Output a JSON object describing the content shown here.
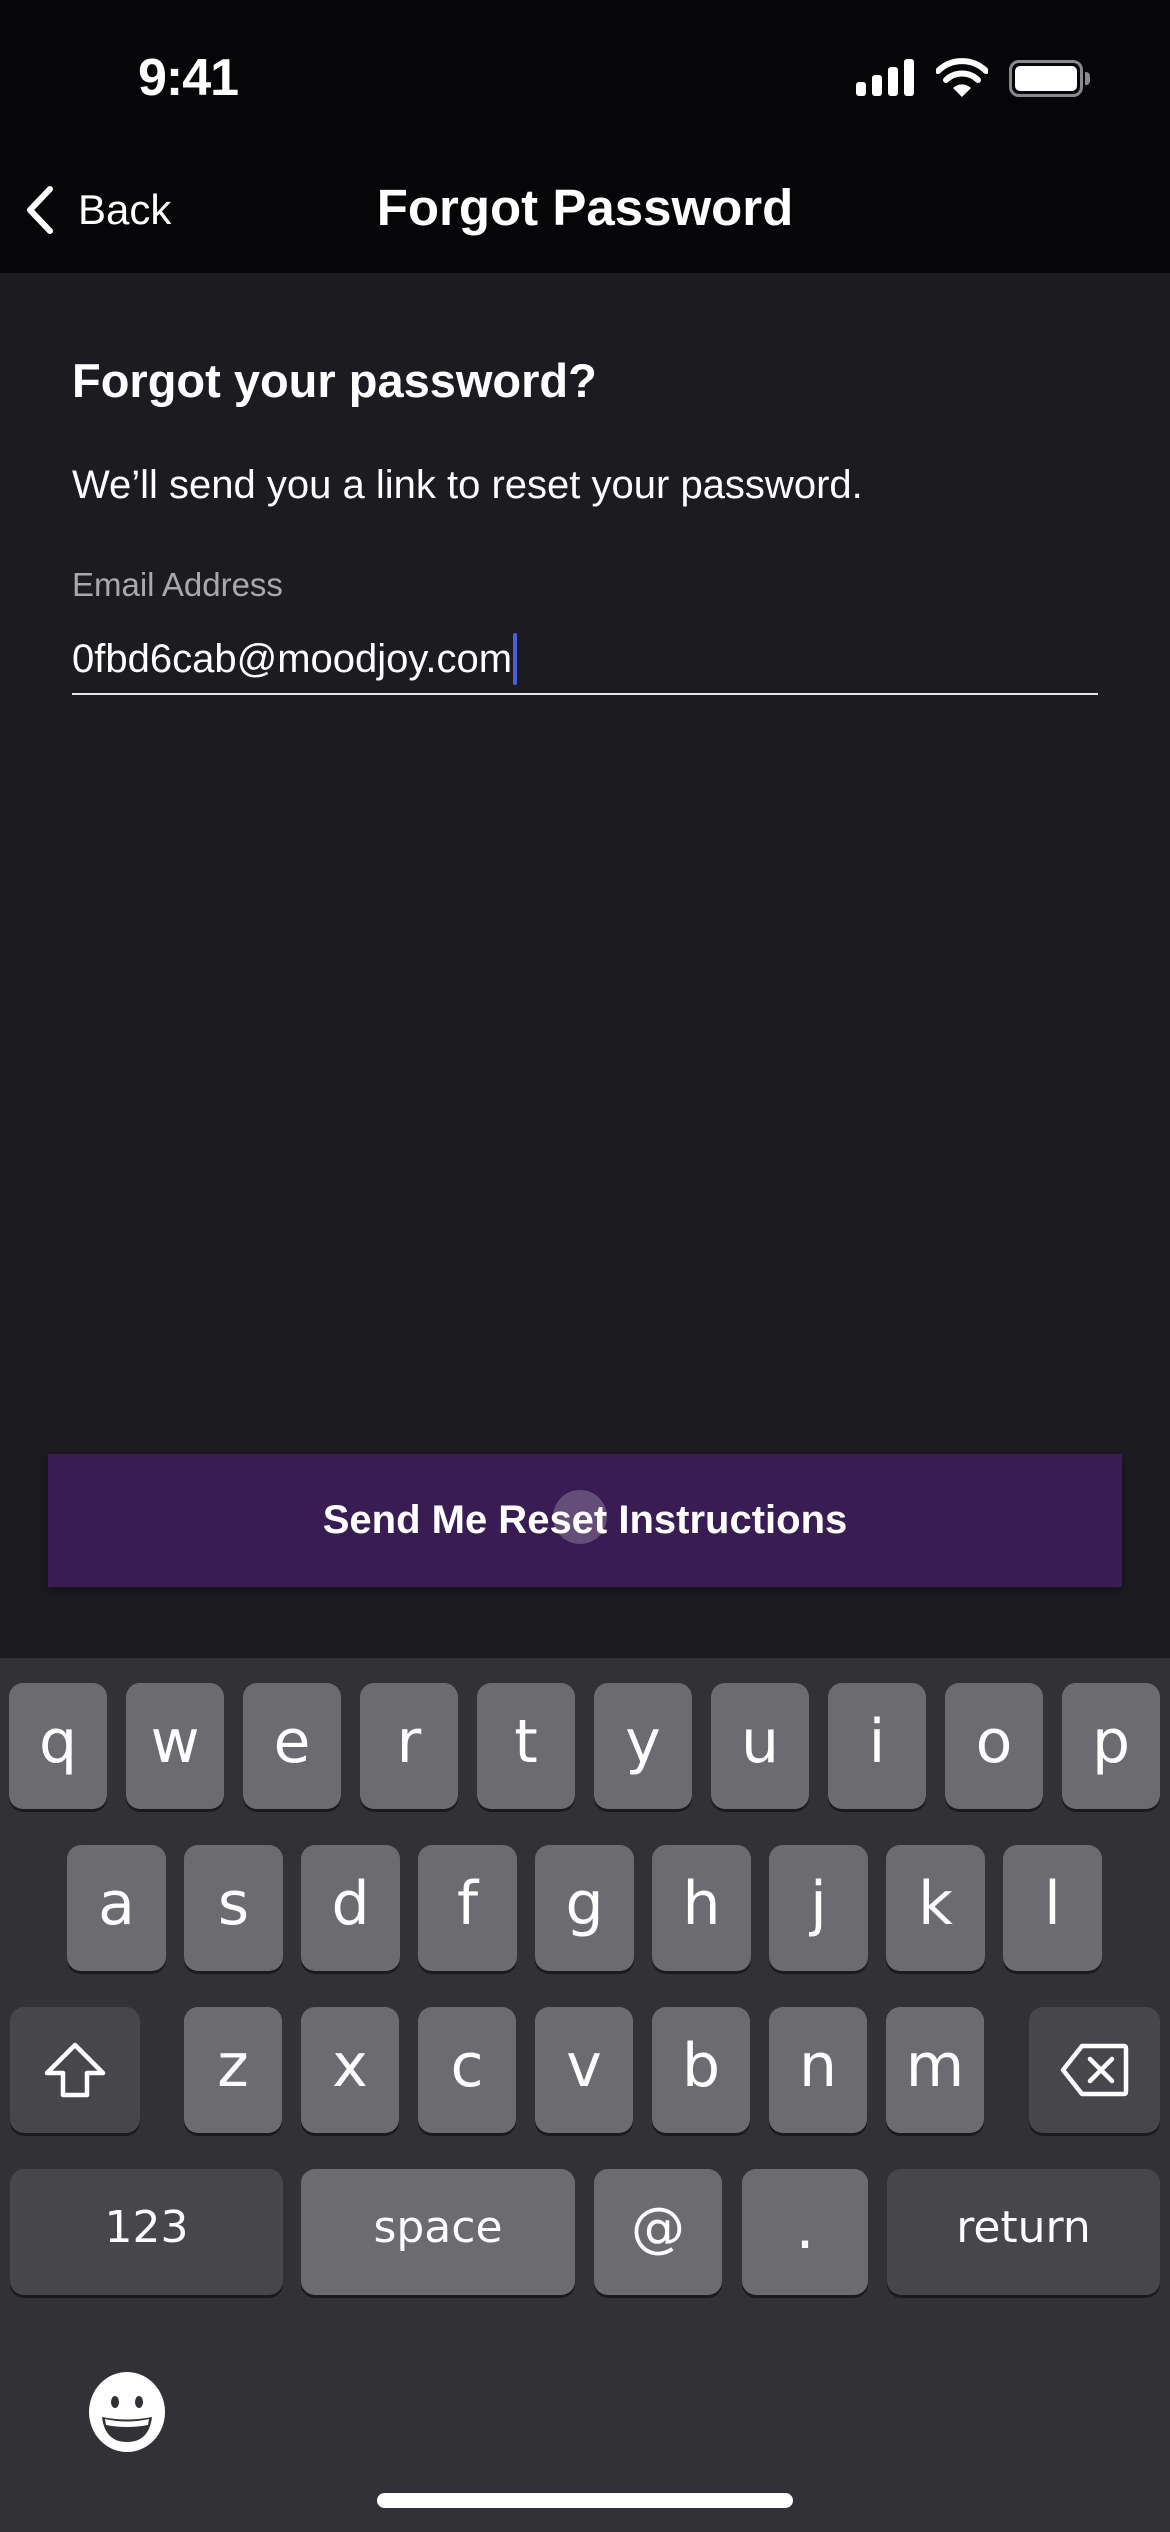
{
  "status_bar": {
    "time": "9:41",
    "icons": [
      "cellular-signal-icon",
      "wifi-icon",
      "battery-icon"
    ]
  },
  "nav": {
    "back_label": "Back",
    "back_icon": "chevron-left-icon",
    "title": "Forgot Password"
  },
  "form": {
    "heading": "Forgot your password?",
    "description": "We’ll send you a link to reset your password.",
    "email_label": "Email Address",
    "email_value": "0fbd6cab@moodjoy.com",
    "submit_label": "Send Me Reset Instructions"
  },
  "colors": {
    "background": "#1c1b20",
    "header": "#060508",
    "button": "#3a1c54",
    "caret": "#4a5fe0",
    "keyboard": "#323136",
    "key": "#6c6b70",
    "special_key": "#47464b"
  },
  "keyboard": {
    "row1": [
      "q",
      "w",
      "e",
      "r",
      "t",
      "y",
      "u",
      "i",
      "o",
      "p"
    ],
    "row2": [
      "a",
      "s",
      "d",
      "f",
      "g",
      "h",
      "j",
      "k",
      "l"
    ],
    "row3": [
      "z",
      "x",
      "c",
      "v",
      "b",
      "n",
      "m"
    ],
    "shift_icon": "shift-arrow-icon",
    "delete_icon": "backspace-icon",
    "numbers_label": "123",
    "space_label": "space",
    "at_label": "@",
    "period_label": ".",
    "return_label": "return",
    "emoji_icon": "emoji-smile-icon"
  }
}
